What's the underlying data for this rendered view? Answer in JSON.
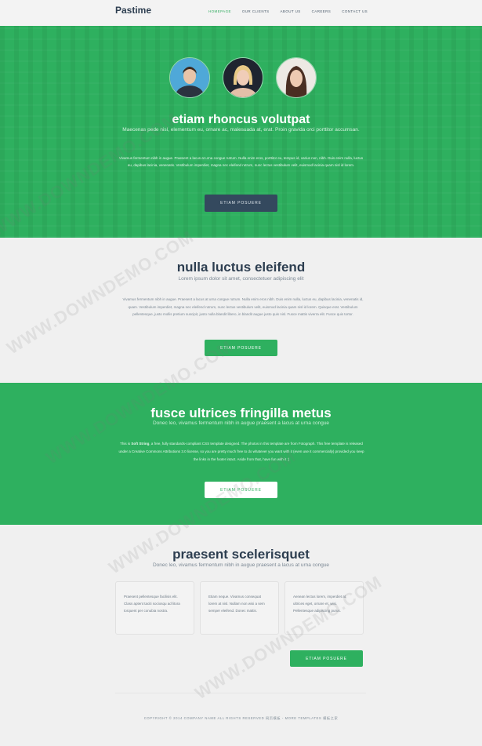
{
  "header": {
    "logo": "Pastime",
    "nav": [
      "HOMEPAGE",
      "OUR CLIENTS",
      "ABOUT US",
      "CAREERS",
      "CONTACT US"
    ]
  },
  "hero": {
    "title": "etiam rhoncus volutpat",
    "subtitle": "Maecenas pede nisl, elementum eu, ornare ac, malesuada at, erat. Proin gravida orci porttitor accumsan.",
    "body": "Vivamus fermentum nibh in augue. Praesent a lacus at urna congue rutrum. Nulla enim eros, porttitor eu, tempus id, varius non, nibh. Duis enim nulla, luctus eu, dapibus lacinia, venenatis. Vestibulum imperdiet, magna nec eleifend rutrum, nunc lectus vestibulum velit, euismod lacinia quam nisl id lorem.",
    "button": "ETIAM POSUERE"
  },
  "section2": {
    "title": "nulla luctus eleifend",
    "subtitle": "Lorem ipsum dolor sit amet, consectetuer adipiscing elit",
    "body": "Vivamus fermentum nibh in augue. Praesent a lacus at urna congue rutrum. Nulla enim eros nibh. Duis enim nulla, luctus eu, dapibus lacinia, venenatis id, quam. Vestibulum imperdiet, magna nec eleifend rutrum, nunc lectus vestibulum velit, euismod lacinia quam nisl id lorem. Quisque erat. Vestibulum pellentesque, justo mollis pretium suscipit, justo nulla blandit libero, in blandit augue justo quis nisl. Fusce mattis viverra elit. Fusce quis tortor.",
    "button": "ETIAM POSUERE"
  },
  "section3": {
    "title": "fusce ultrices fringilla metus",
    "subtitle": "Donec leo, vivamus fermentum nibh in augue praesent a lacus at urna congue",
    "body_pre": "This is ",
    "body_bold": "Soft String",
    "body_post": ", a free, fully standards-compliant CSS template designed. The photos in this template are from Fotograph. This free template is released under a Creative Commons Attributions 3.0 license, so you are pretty much free to do whatever you want with it (even use it commercially) provided you keep the links in the footer intact. Aside from that, have fun with it :)",
    "button": "ETIAM POSUERE"
  },
  "section4": {
    "title": "praesent scelerisquet",
    "subtitle": "Donec leo, vivamus fermentum nibh in augue praesent a lacus at urna congue",
    "cards": [
      "Praesent pellentesque facilisis elit. Class aptent taciti sociosqu ad litora torquent per conubia nostra.",
      "Etiam neque. Vivamus consequat lorem at nisl. Nullam non wisi a sem semper eleifend. Donec mattis.",
      "Aenean lectus lorem, imperdiet at, ultrices eget, ornare et, wisi. Pellentesque adipiscing purus."
    ],
    "button": "ETIAM POSUERE"
  },
  "footer": {
    "text": "COPYRIGHT © 2014 COMPANY NAME ALL RIGHTS RESERVED 网页模板 - MORE TEMPLATES 模板之家"
  },
  "watermark": "WWW.DOWNDEMO.COM",
  "colors": {
    "accent_green": "#2eb05f",
    "dark_button": "#34495e",
    "heading": "#2d3e50"
  }
}
